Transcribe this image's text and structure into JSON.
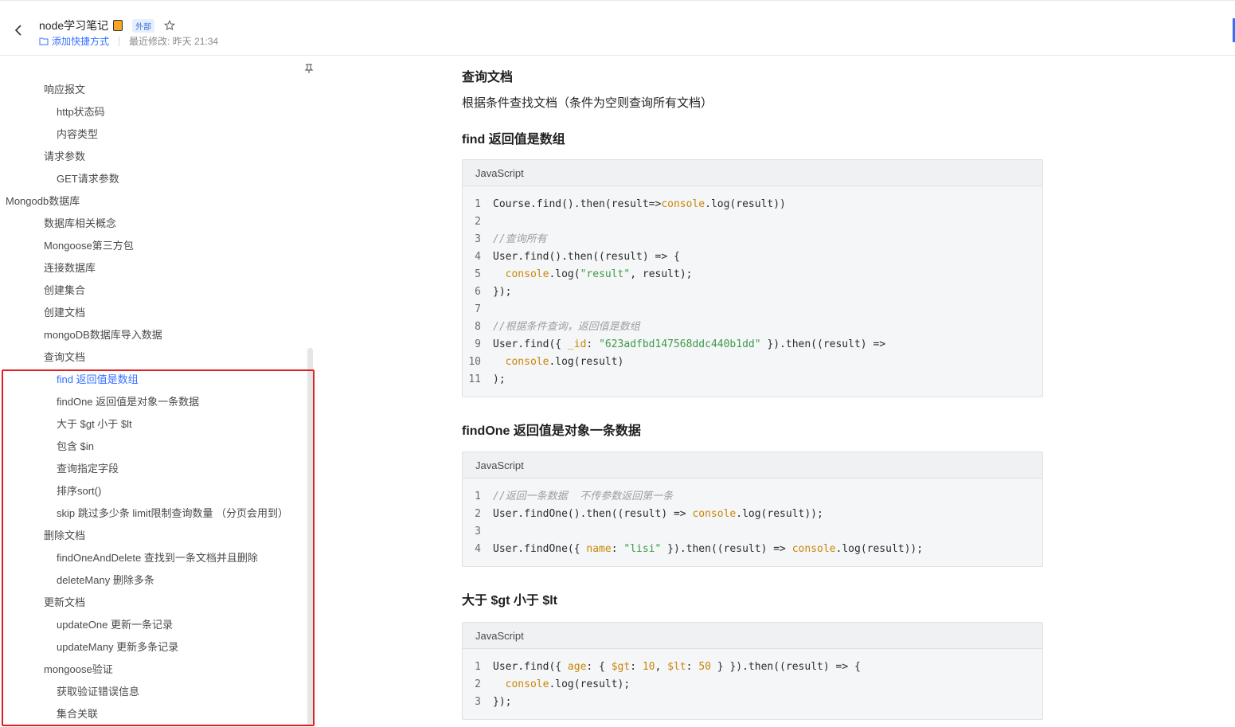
{
  "header": {
    "title": "node学习笔记",
    "external_badge": "外部",
    "add_shortcut": "添加快捷方式",
    "last_modified": "最近修改: 昨天 21:34"
  },
  "sidebar": {
    "items": [
      {
        "label": "响应报文",
        "level": 1
      },
      {
        "label": "http状态码",
        "level": 2
      },
      {
        "label": "内容类型",
        "level": 2
      },
      {
        "label": "请求参数",
        "level": 1
      },
      {
        "label": "GET请求参数",
        "level": 2
      },
      {
        "label": "Mongodb数据库",
        "level": 0
      },
      {
        "label": "数据库相关概念",
        "level": 1
      },
      {
        "label": "Mongoose第三方包",
        "level": 1
      },
      {
        "label": "连接数据库",
        "level": 1
      },
      {
        "label": "创建集合",
        "level": 1
      },
      {
        "label": "创建文档",
        "level": 1
      },
      {
        "label": "mongoDB数据库导入数据",
        "level": 1
      },
      {
        "label": "查询文档",
        "level": 1
      },
      {
        "label": "find 返回值是数组",
        "level": 2,
        "active": true
      },
      {
        "label": "findOne 返回值是对象一条数据",
        "level": 2
      },
      {
        "label": "大于 $gt 小于 $lt",
        "level": 2
      },
      {
        "label": "包含 $in",
        "level": 2
      },
      {
        "label": "查询指定字段",
        "level": 2
      },
      {
        "label": "排序sort()",
        "level": 2
      },
      {
        "label": "skip 跳过多少条 limit限制查询数量 （分页会用到）",
        "level": 2
      },
      {
        "label": "删除文档",
        "level": 1
      },
      {
        "label": "findOneAndDelete 查找到一条文档并且删除",
        "level": 2
      },
      {
        "label": "deleteMany 删除多条",
        "level": 2
      },
      {
        "label": "更新文档",
        "level": 1
      },
      {
        "label": "updateOne 更新一条记录",
        "level": 2
      },
      {
        "label": "updateMany 更新多条记录",
        "level": 2
      },
      {
        "label": "mongoose验证",
        "level": 1
      },
      {
        "label": "获取验证错误信息",
        "level": 2
      },
      {
        "label": "集合关联",
        "level": 2
      }
    ]
  },
  "content": {
    "section_title": "查询文档",
    "section_desc": "根据条件查找文档（条件为空则查询所有文档）",
    "blocks": [
      {
        "heading": "find 返回值是数组",
        "lang": "JavaScript",
        "lines": [
          [
            [
              "Course.find().then(result=>",
              "t"
            ],
            [
              "console",
              "o"
            ],
            [
              ".log(result))",
              "t"
            ]
          ],
          [],
          [
            [
              "//查询所有",
              "c"
            ]
          ],
          [
            [
              "User.find().then((result) => {",
              "t"
            ]
          ],
          [
            [
              "  ",
              "t"
            ],
            [
              "console",
              "o"
            ],
            [
              ".log(",
              "t"
            ],
            [
              "\"result\"",
              "g"
            ],
            [
              ", result);",
              "t"
            ]
          ],
          [
            [
              "});",
              "t"
            ]
          ],
          [],
          [
            [
              "//根据条件查询，返回值是数组",
              "c"
            ]
          ],
          [
            [
              "User.find({ ",
              "t"
            ],
            [
              "_id",
              "o"
            ],
            [
              ": ",
              "t"
            ],
            [
              "\"623adfbd147568ddc440b1dd\"",
              "g"
            ],
            [
              " }).then((result) =>",
              "t"
            ]
          ],
          [
            [
              "  ",
              "t"
            ],
            [
              "console",
              "o"
            ],
            [
              ".log(result)",
              "t"
            ]
          ],
          [
            [
              ");",
              "t"
            ]
          ]
        ]
      },
      {
        "heading": "findOne 返回值是对象一条数据",
        "lang": "JavaScript",
        "lines": [
          [
            [
              "//返回一条数据  不传参数返回第一条",
              "c"
            ]
          ],
          [
            [
              "User.findOne().then((result) => ",
              "t"
            ],
            [
              "console",
              "o"
            ],
            [
              ".log(result));",
              "t"
            ]
          ],
          [],
          [
            [
              "User.findOne({ ",
              "t"
            ],
            [
              "name",
              "o"
            ],
            [
              ": ",
              "t"
            ],
            [
              "\"lisi\"",
              "g"
            ],
            [
              " }).then((result) => ",
              "t"
            ],
            [
              "console",
              "o"
            ],
            [
              ".log(result));",
              "t"
            ]
          ]
        ]
      },
      {
        "heading": "大于 $gt 小于 $lt",
        "lang": "JavaScript",
        "lines": [
          [
            [
              "User.find({ ",
              "t"
            ],
            [
              "age",
              "o"
            ],
            [
              ": { ",
              "t"
            ],
            [
              "$gt",
              "o"
            ],
            [
              ": ",
              "t"
            ],
            [
              "10",
              "o"
            ],
            [
              ", ",
              "t"
            ],
            [
              "$lt",
              "o"
            ],
            [
              ": ",
              "t"
            ],
            [
              "50",
              "o"
            ],
            [
              " } }).then((result) => {",
              "t"
            ]
          ],
          [
            [
              "  ",
              "t"
            ],
            [
              "console",
              "o"
            ],
            [
              ".log(result);",
              "t"
            ]
          ],
          [
            [
              "});",
              "t"
            ]
          ]
        ]
      }
    ]
  },
  "colors": {
    "accent": "#3370ff",
    "highlight_border": "#e02020",
    "code_comment": "#9aa0a6",
    "code_keyword": "#c8860a",
    "code_string": "#3d9a4a"
  }
}
